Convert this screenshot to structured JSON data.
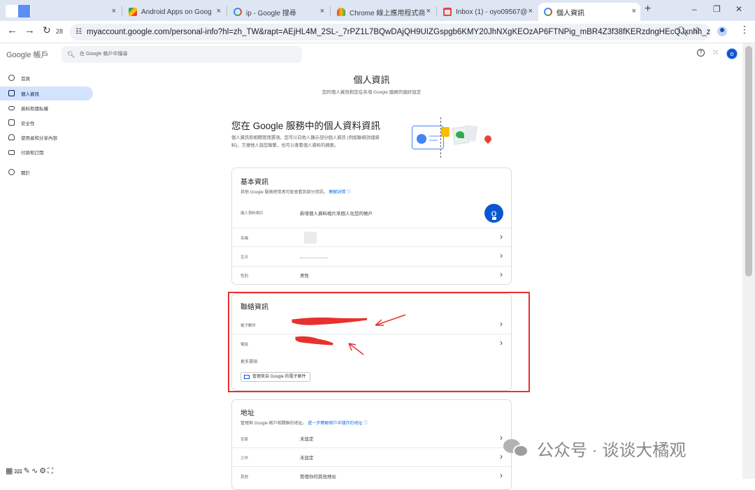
{
  "browser": {
    "tabs": [
      {
        "title": "",
        "close": "×"
      },
      {
        "title": "Android Apps on Goog",
        "close": "×"
      },
      {
        "title": "ip - Google 搜尋",
        "close": "×"
      },
      {
        "title": "Chrome 線上應用程式商",
        "close": "×"
      },
      {
        "title": "Inbox (1) - oyo09567@",
        "close": "×"
      },
      {
        "title": "個人資訊",
        "close": "×"
      }
    ],
    "new_tab": "+",
    "minimize": "–",
    "restore": "❐",
    "close_window": "✕",
    "badge_count": "28",
    "url": "myaccount.google.com/personal-info?hl=zh_TW&rapt=AEjHL4M_2SL-_7rPZ1L7BQwDAjQH9UIZGspgb6KMY20JhNXgKEOzAP6FTNPig_mBR4Z3f38fKERzdngHEcQJxnhh_z_Q..."
  },
  "header": {
    "logo_google": "Google",
    "logo_suffix": "帳戶",
    "search_placeholder": "在 Google 帳戶中搜尋",
    "avatar_letter": "o"
  },
  "sidebar": {
    "items": [
      {
        "label": "首頁"
      },
      {
        "label": "個人資訊"
      },
      {
        "label": "資料和隱私權"
      },
      {
        "label": "安全性"
      },
      {
        "label": "使用者和分享內容"
      },
      {
        "label": "付款和訂閱"
      },
      {
        "label": "關於"
      }
    ]
  },
  "main": {
    "title": "個人資訊",
    "subtitle": "您的個人資訊和您在各項 Google 服務的偏好設定",
    "intro_heading": "您在 Google 服務中的個人資料資訊",
    "intro_text": "個人資訊和相關管理選項，您可以向他人顯示部分個人資訊 (例如聯絡詳細資料)，方便他人與您聯繫，也可以查看個人資料的摘要。",
    "basic": {
      "title": "基本資訊",
      "subtitle": "其他 Google 服務使用者可能會看到部分資訊。",
      "learn_more": "瞭解詳情",
      "rows": [
        {
          "label": "個人資料相片",
          "value": "新增個人資料相片來個人化您的帳戶"
        },
        {
          "label": "名稱",
          "value": ""
        },
        {
          "label": "生日",
          "value": ""
        },
        {
          "label": "性別",
          "value": "男性"
        }
      ],
      "photo_letter": "o"
    },
    "contact": {
      "title": "聯絡資訊",
      "rows": [
        {
          "label": "電子郵件"
        },
        {
          "label": "電話"
        }
      ],
      "more_options": "更多選項",
      "manage_button": "管理來自 Google 的電子郵件"
    },
    "address": {
      "title": "地址",
      "subtitle": "管理與 Google 帳戶相關聯的地址。",
      "learn_more": "進一步瞭解帳戶中儲存的地址",
      "rows": [
        {
          "label": "住家",
          "value": "未設定"
        },
        {
          "label": "工作",
          "value": "未設定"
        },
        {
          "label": "其他",
          "value": "管理你的其他地址"
        }
      ]
    }
  },
  "watermark": {
    "text": "公众号 · 谈谈大橘观"
  },
  "colors": {
    "accent": "#1a73e8",
    "active_nav_bg": "#d3e3fd",
    "annotation_red": "#e8312f",
    "avatar_blue": "#0b57d0"
  }
}
